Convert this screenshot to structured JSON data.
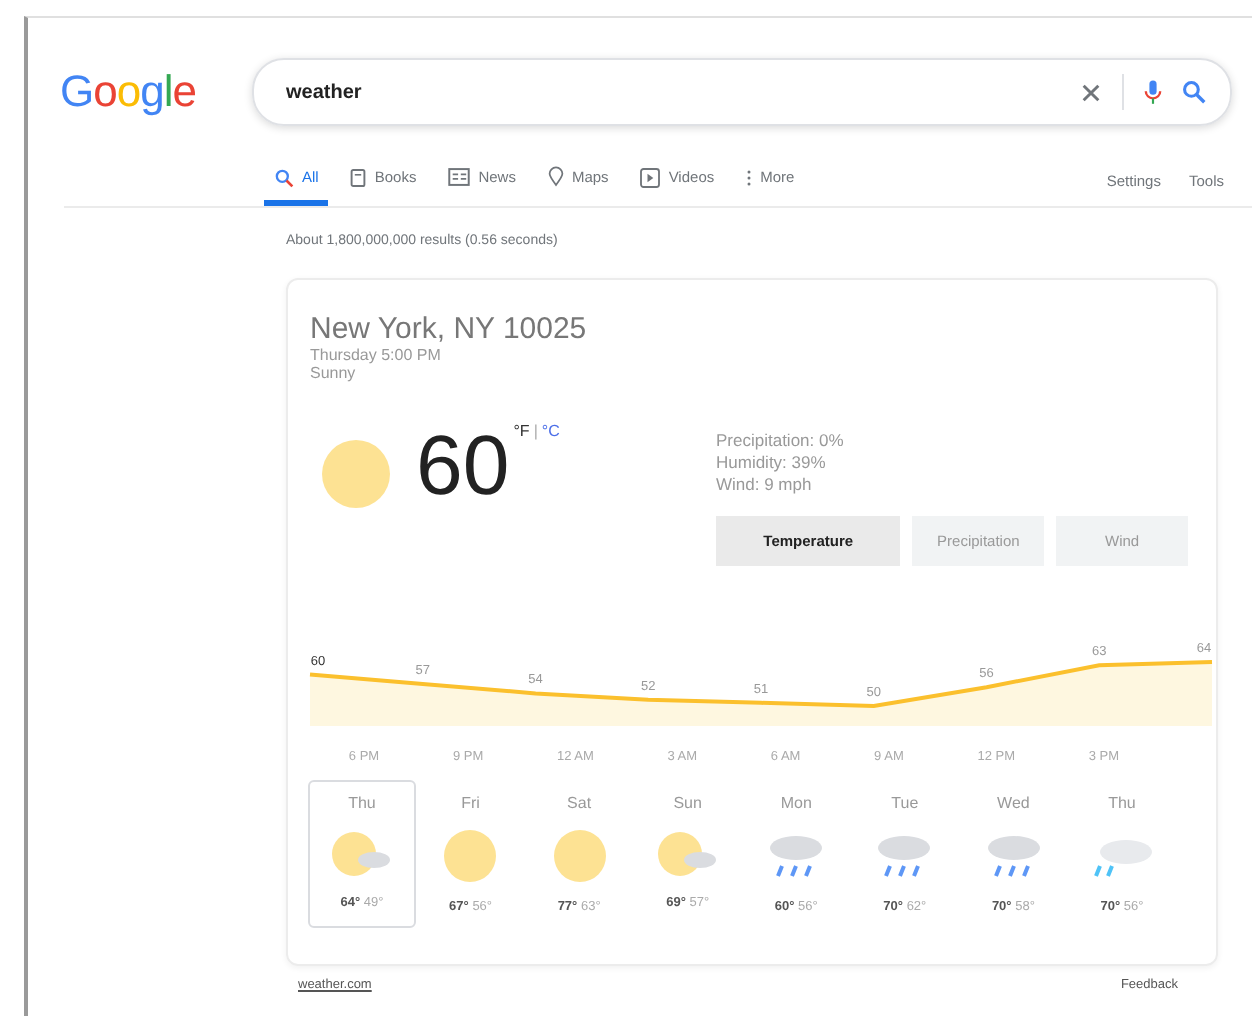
{
  "logo": "Google",
  "search": {
    "query": "weather"
  },
  "tabs": [
    {
      "label": "All",
      "selected": true
    },
    {
      "label": "Books",
      "selected": false
    },
    {
      "label": "News",
      "selected": false
    },
    {
      "label": "Maps",
      "selected": false
    },
    {
      "label": "Videos",
      "selected": false
    },
    {
      "label": "More",
      "selected": false
    }
  ],
  "tools": [
    "Settings",
    "Tools"
  ],
  "result_stats": "About 1,800,000,000 results (0.56 seconds)",
  "weather": {
    "location": "New York, NY 10025",
    "time": "Thursday 5:00 PM",
    "condition": "Sunny",
    "temperature": "60",
    "units": [
      {
        "label": "°F",
        "selected": true
      },
      {
        "label": "°C",
        "selected": false
      }
    ],
    "unit_separator": "|",
    "details": [
      "Precipitation: 0%",
      "Humidity: 39%",
      "Wind: 9 mph"
    ],
    "views": [
      {
        "label": "Temperature",
        "selected": true
      },
      {
        "label": "Precipitation",
        "selected": false
      },
      {
        "label": "Wind",
        "selected": false
      }
    ],
    "chart_data": {
      "type": "area",
      "series": [
        {
          "color": "#fbc02d",
          "values": [
            60,
            57,
            54,
            52,
            51,
            50,
            56,
            63,
            64
          ]
        }
      ],
      "data_labels": true
    },
    "hours": [
      "6 PM",
      "9 PM",
      "12 AM",
      "3 AM",
      "6 AM",
      "9 AM",
      "12 PM",
      "3 PM"
    ],
    "days": [
      {
        "day": "Thu",
        "kind": "sun-cloud",
        "high": "64°",
        "low": "49°",
        "selected": true
      },
      {
        "day": "Fri",
        "kind": "sun",
        "high": "67°",
        "low": "56°",
        "selected": false
      },
      {
        "day": "Sat",
        "kind": "sun",
        "high": "77°",
        "low": "63°",
        "selected": false
      },
      {
        "day": "Sun",
        "kind": "sun-cloud",
        "high": "69°",
        "low": "57°",
        "selected": false
      },
      {
        "day": "Mon",
        "kind": "rain",
        "high": "60°",
        "low": "56°",
        "selected": false
      },
      {
        "day": "Tue",
        "kind": "rain",
        "high": "70°",
        "low": "62°",
        "selected": false
      },
      {
        "day": "Wed",
        "kind": "rain",
        "high": "70°",
        "low": "58°",
        "selected": false
      },
      {
        "day": "Thu",
        "kind": "showers",
        "high": "70°",
        "low": "56°",
        "selected": false
      }
    ]
  },
  "footer": {
    "source": "weather.com",
    "feedback": "Feedback"
  }
}
